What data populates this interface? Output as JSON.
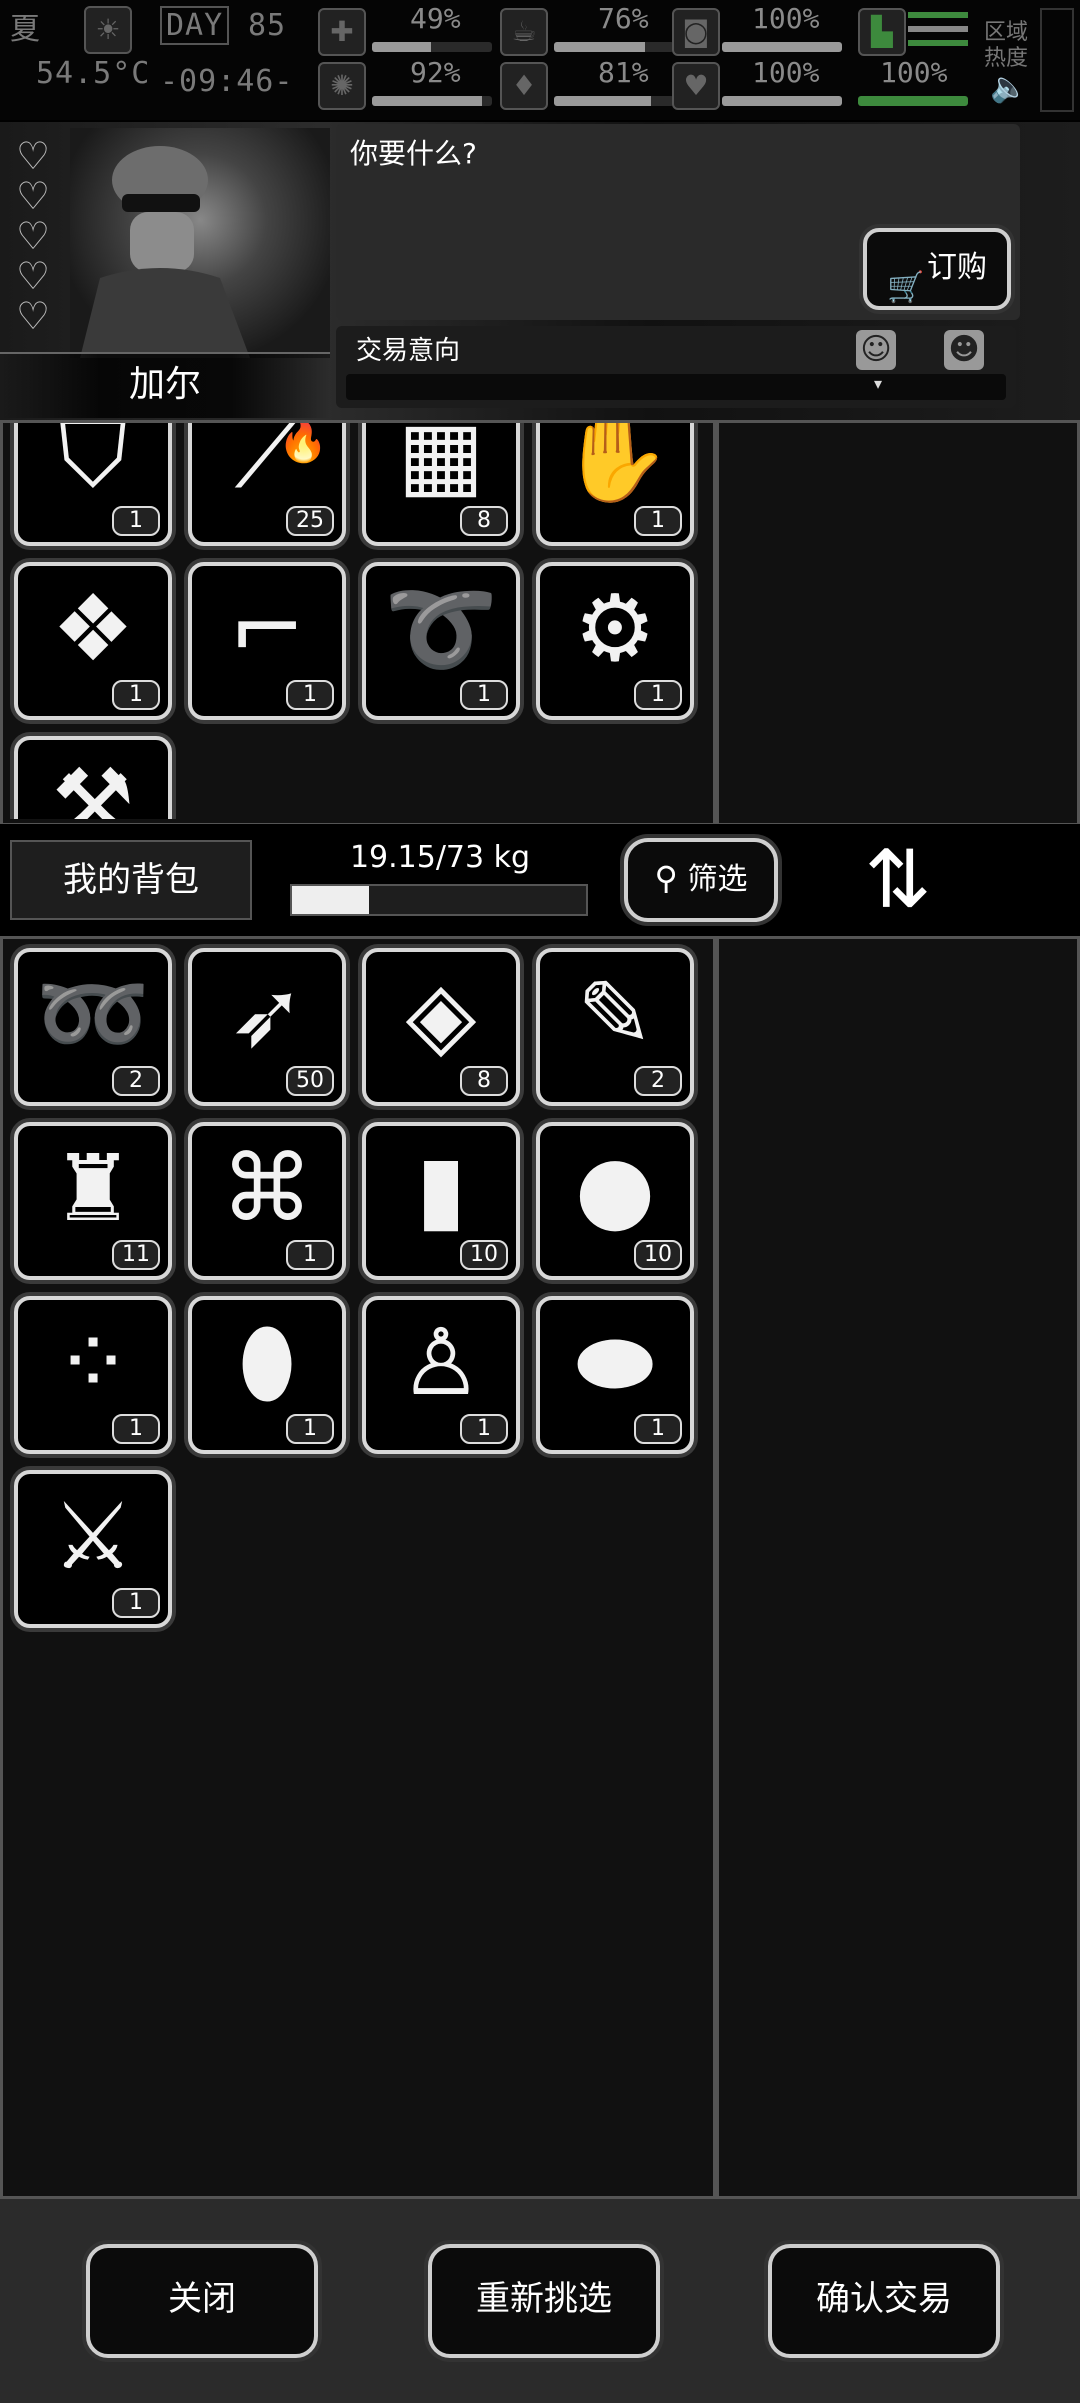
{
  "status": {
    "season": "夏",
    "day_label": "DAY",
    "day_number": "85",
    "temperature": "54.5°C",
    "time": "-09:46-",
    "zone_heat_label_1": "区域",
    "zone_heat_label_2": "热度",
    "stats": [
      {
        "icon": "medkit-icon",
        "value": "49%",
        "level": 0.49
      },
      {
        "icon": "food-icon",
        "value": "76%",
        "level": 0.76
      },
      {
        "icon": "stamina-icon",
        "value": "100%",
        "level": 1.0
      },
      {
        "icon": "brain-icon",
        "value": "92%",
        "level": 0.92
      },
      {
        "icon": "water-drop-icon",
        "value": "81%",
        "level": 0.81
      },
      {
        "icon": "heart-icon",
        "value": "100%",
        "level": 1.0
      },
      {
        "icon": "boot-icon",
        "value": "100%",
        "level": 1.0
      }
    ]
  },
  "trader": {
    "name": "加尔",
    "hearts": 5,
    "dialog": "你要什么?",
    "order_button": "订购",
    "intent_label": "交易意向",
    "intent_level": 0.5
  },
  "trader_items": [
    {
      "name": "folding-chair-icon",
      "glyph": "⛉",
      "count": "1"
    },
    {
      "name": "torch-icon",
      "glyph": "⟋",
      "count": "25",
      "burning": true
    },
    {
      "name": "dynamite-bundle-icon",
      "glyph": "▦",
      "count": "8"
    },
    {
      "name": "glove-icon",
      "glyph": "✋",
      "count": "1"
    },
    {
      "name": "bandage-pack-icon",
      "glyph": "❖",
      "count": "1"
    },
    {
      "name": "smg-icon",
      "glyph": "⌐",
      "count": "1"
    },
    {
      "name": "fishing-line-icon",
      "glyph": "➰",
      "count": "1"
    },
    {
      "name": "holster-icon",
      "glyph": "⚙",
      "count": "1"
    },
    {
      "name": "axe-icon",
      "glyph": "⚒",
      "count": ""
    }
  ],
  "backpack": {
    "title": "我的背包",
    "weight_text": "19.15/73 kg",
    "weight_ratio": 0.262,
    "filter_button": "筛选"
  },
  "backpack_items": [
    {
      "name": "rope-icon",
      "glyph": "➿",
      "count": "2"
    },
    {
      "name": "arrow-icon",
      "glyph": "➶",
      "count": "50"
    },
    {
      "name": "dried-meat-icon",
      "glyph": "◈",
      "count": "8"
    },
    {
      "name": "syringe-icon",
      "glyph": "✎",
      "count": "2"
    },
    {
      "name": "fuel-canisters-icon",
      "glyph": "♜",
      "count": "11"
    },
    {
      "name": "cloth-rolls-icon",
      "glyph": "⌘",
      "count": "1"
    },
    {
      "name": "water-bottle-icon",
      "glyph": "▮",
      "count": "10"
    },
    {
      "name": "potato-icon",
      "glyph": "●",
      "count": "10"
    },
    {
      "name": "beads-icon",
      "glyph": "⁘",
      "count": "1"
    },
    {
      "name": "bullet-icon",
      "glyph": "⬮",
      "count": "1"
    },
    {
      "name": "torn-shirt-icon",
      "glyph": "♙",
      "count": "1"
    },
    {
      "name": "bullets-icon",
      "glyph": "⬬",
      "count": "1"
    },
    {
      "name": "machete-icon",
      "glyph": "⚔",
      "count": "1"
    }
  ],
  "buttons": {
    "close": "关闭",
    "reselect": "重新挑选",
    "confirm": "确认交易"
  }
}
